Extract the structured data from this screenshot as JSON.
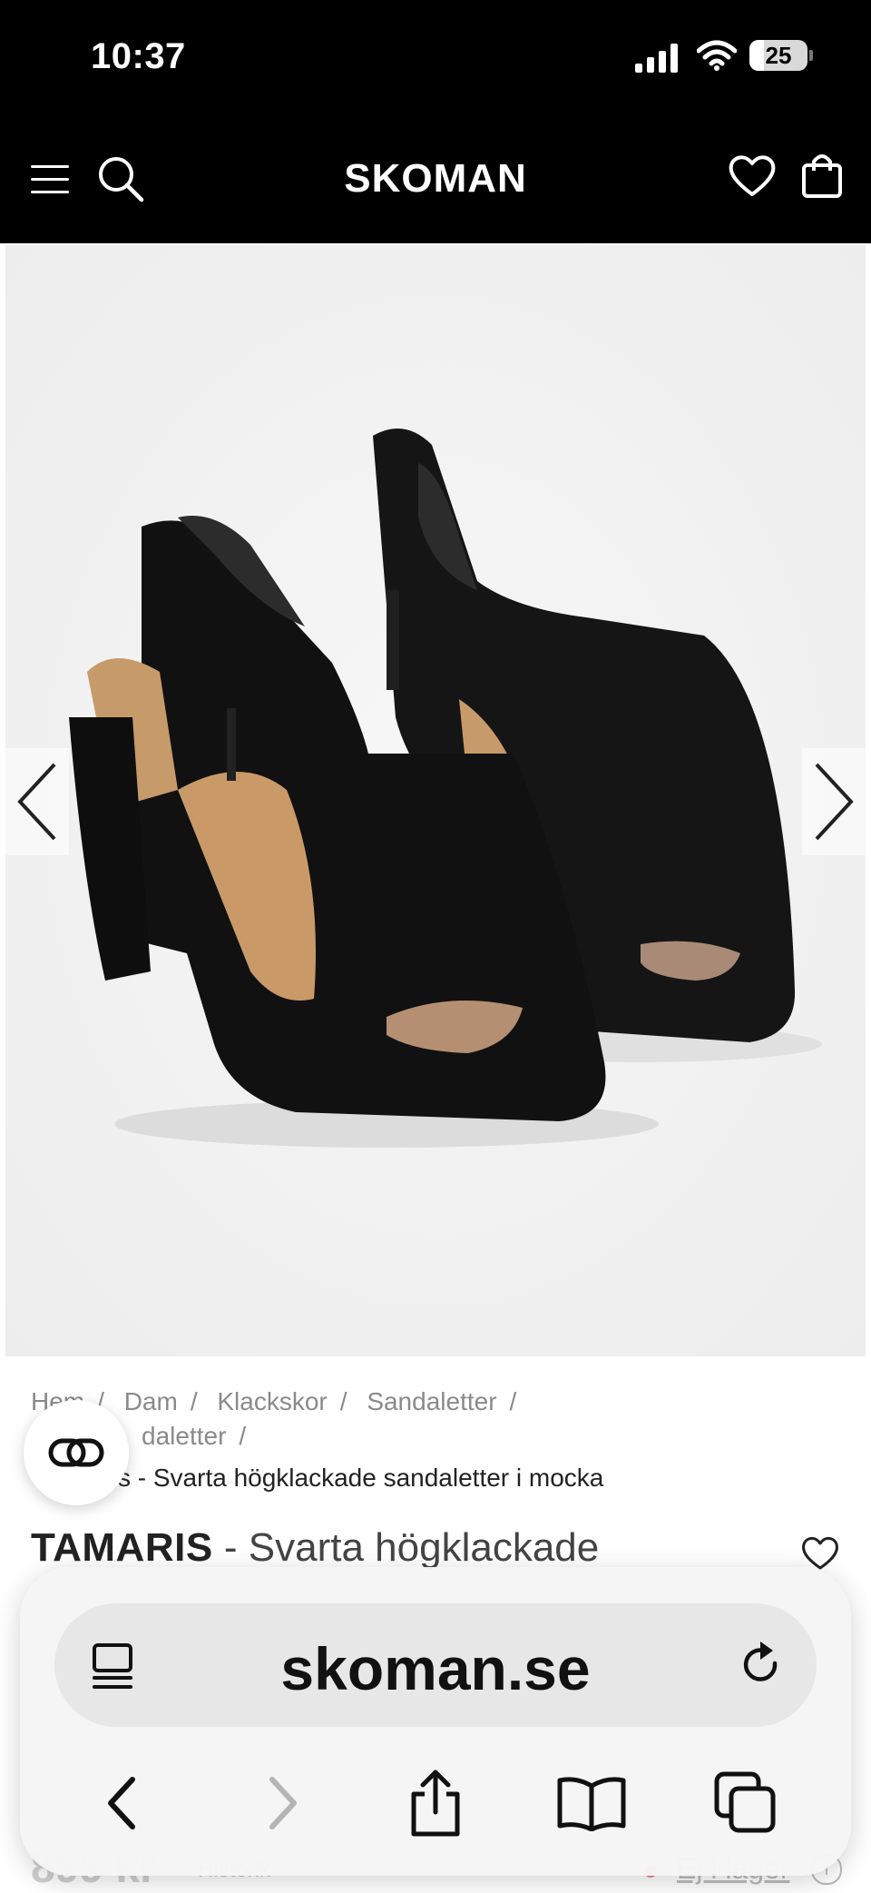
{
  "status_bar": {
    "time": "10:37",
    "battery": "25",
    "battery_level": 0.25
  },
  "nav": {
    "brand": "SKOMAN"
  },
  "breadcrumb": {
    "items": [
      "Hem",
      "Dam",
      "Klackskor",
      "Sandaletter"
    ],
    "line2": "Sandaletter",
    "current": "Tamaris - Svarta högklackade sandaletter i mocka",
    "current_visible": "s - Svarta högklackade sandaletter i mocka",
    "item1_visible": "Hem",
    "line2_visible": "daletter"
  },
  "product": {
    "brand": "TAMARIS",
    "title": " - Svarta högklackade",
    "price": "899 kr",
    "price_note": "Historik",
    "stock": "Ej i lager"
  },
  "browser": {
    "url": "skoman.se"
  },
  "colors": {
    "header_bg": "#000000",
    "accent": "#111111",
    "muted": "#8a8a8a"
  },
  "icons": {
    "menu": "hamburger-icon",
    "search": "search-icon",
    "wishlist": "heart-icon",
    "cart": "shopping-bag-icon",
    "chat": "chat-icon",
    "reader": "reader-mode-icon",
    "reload": "reload-icon",
    "back": "chevron-left-icon",
    "forward": "chevron-right-icon",
    "share": "share-icon",
    "bookmarks": "book-icon",
    "tabs": "tabs-icon"
  }
}
